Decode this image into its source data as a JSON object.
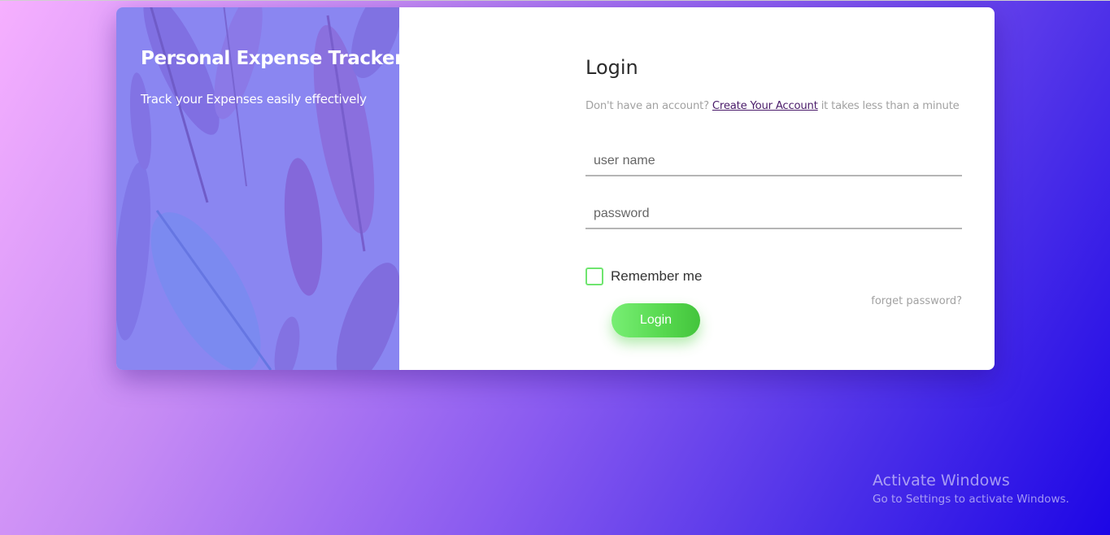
{
  "brand": {
    "title": "Personal Expense Tracker",
    "subtitle": "Track your Expenses easily effectively"
  },
  "login_form": {
    "heading": "Login",
    "signup_prompt": "Don't have an account?",
    "signup_link": "Create Your Account",
    "signup_suffix": "it takes less than a minute",
    "username_placeholder": "user name",
    "password_placeholder": "password",
    "remember_label": "Remember me",
    "remember_checked": false,
    "forgot_label": "forget password?",
    "submit_label": "Login"
  },
  "watermark": {
    "title": "Activate Windows",
    "subtitle": "Go to Settings to activate Windows."
  },
  "colors": {
    "accent_green": "#56d84e",
    "panel_purple": "#8a86f2",
    "link": "#4a1b6a"
  }
}
